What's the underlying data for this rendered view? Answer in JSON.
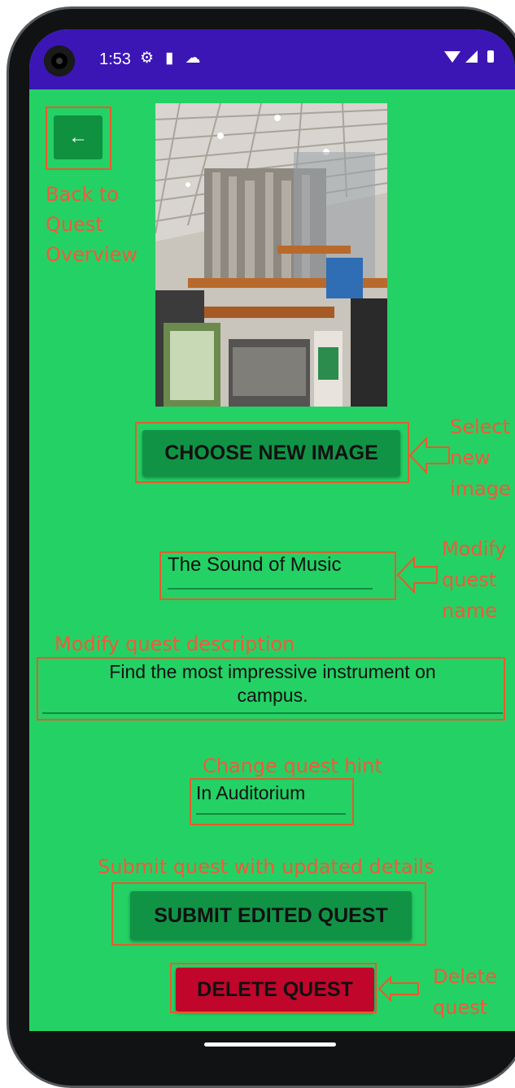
{
  "status_bar": {
    "time": "1:53",
    "icons": [
      "settings-icon",
      "sd-card-icon",
      "cloud-icon",
      "wifi-icon",
      "signal-icon",
      "battery-icon"
    ]
  },
  "colors": {
    "background": "#24d165",
    "status_bar": "#3b16b5",
    "button": "#119346",
    "delete_button": "#c0062a",
    "annotation": "#e85a2e"
  },
  "toolbar": {
    "back_icon": "arrow-left-icon"
  },
  "quest": {
    "choose_image_label": "CHOOSE NEW IMAGE",
    "name_value": "The Sound of Music",
    "description_line1": "Find the most impressive instrument on",
    "description_line2": "campus.",
    "hint_value": "In Auditorium",
    "submit_label": "SUBMIT EDITED QUEST",
    "delete_label": "DELETE QUEST"
  },
  "annotations": {
    "back": [
      "Back to",
      "Quest",
      "Overview"
    ],
    "select_image": [
      "Select",
      "new",
      "image"
    ],
    "modify_name": [
      "Modify",
      "quest",
      "name"
    ],
    "modify_description": "Modify quest  description",
    "change_hint": "Change quest hint",
    "submit": "Submit quest with updated details",
    "delete": [
      "Delete",
      "quest"
    ]
  }
}
